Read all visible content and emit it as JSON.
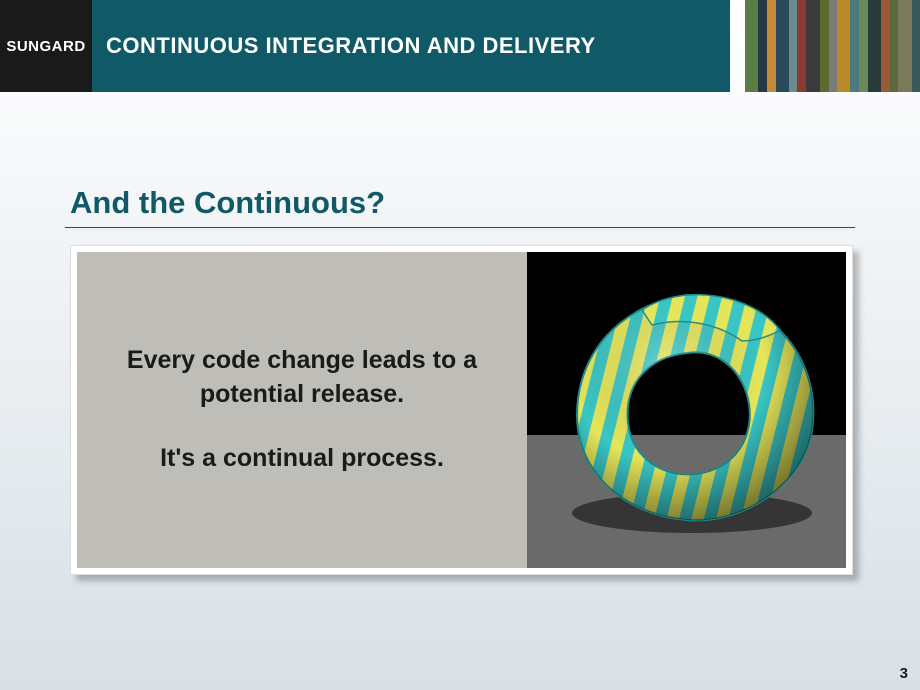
{
  "header": {
    "logo": "SUNGARD",
    "deck_title": "CONTINUOUS INTEGRATION AND DELIVERY"
  },
  "slide": {
    "title": "And the Continuous?",
    "body_line_1": "Every code change leads to a potential release.",
    "body_line_2": "It's a continual process.",
    "page_number": "3"
  },
  "stripes": [
    "#5a7d46",
    "#273845",
    "#c48a3a",
    "#2a4a5c",
    "#6a8a8e",
    "#8a3a32",
    "#3a3a3a",
    "#5c6a2e",
    "#7a7a7a",
    "#b88a2a",
    "#4a7a7e",
    "#6a8a5a",
    "#2a3a3a",
    "#9a5a3a",
    "#5a6a3a",
    "#7a7a5a",
    "#3a5a5a"
  ],
  "illustration": {
    "name": "mobius-strip",
    "stripe_a": "#3ac6c6",
    "stripe_b": "#e6e65a"
  }
}
